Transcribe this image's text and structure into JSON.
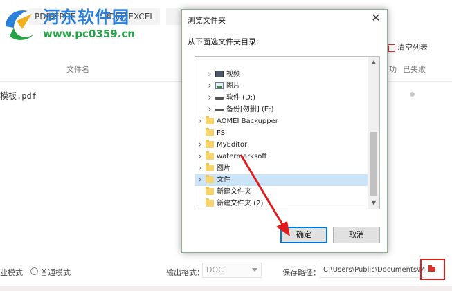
{
  "watermark": {
    "title": "河东软件园",
    "url": "www.pc0359.cn"
  },
  "app": {
    "tabs": [
      "PDF转PDF",
      "PDF转EXCEL"
    ],
    "clear_list_label": "清空列表",
    "columns": {
      "file_name": "文件名",
      "success": "功",
      "failed": "已失败"
    },
    "file_row": {
      "name": "模板.pdf"
    },
    "mode": {
      "fast_label": "业模式",
      "normal_label": "普通模式"
    },
    "output_format_label": "输出格式：",
    "output_format_value": "DOC",
    "save_path_label": "保存路径：",
    "save_path_value": "C:\\Users\\Public\\Documents\\Mini"
  },
  "dialog": {
    "title": "浏览文件夹",
    "prompt": "从下面选文件夹目录:",
    "tree": [
      {
        "label": "视频",
        "icon": "video-icon",
        "indent": 1,
        "expandable": true,
        "selected": false
      },
      {
        "label": "图片",
        "icon": "image-icon",
        "indent": 1,
        "expandable": true,
        "selected": false
      },
      {
        "label": "软件 (D:)",
        "icon": "drive-icon",
        "indent": 1,
        "expandable": true,
        "selected": false
      },
      {
        "label": "备份[勿删] (E:)",
        "icon": "drive-icon",
        "indent": 1,
        "expandable": true,
        "selected": false
      },
      {
        "label": "AOMEI Backupper",
        "icon": "folder-icon",
        "indent": 0,
        "expandable": true,
        "selected": false
      },
      {
        "label": "FS",
        "icon": "folder-icon",
        "indent": 0,
        "expandable": false,
        "selected": false
      },
      {
        "label": "MyEditor",
        "icon": "folder-icon",
        "indent": 0,
        "expandable": true,
        "selected": false
      },
      {
        "label": "watermarksoft",
        "icon": "folder-icon",
        "indent": 0,
        "expandable": true,
        "selected": false
      },
      {
        "label": "图片",
        "icon": "folder-icon",
        "indent": 0,
        "expandable": true,
        "selected": false
      },
      {
        "label": "文件",
        "icon": "folder-icon",
        "indent": 0,
        "expandable": true,
        "selected": true
      },
      {
        "label": "新建文件夹",
        "icon": "folder-icon",
        "indent": 0,
        "expandable": false,
        "selected": false
      },
      {
        "label": "新建文件夹 (2)",
        "icon": "folder-icon",
        "indent": 0,
        "expandable": false,
        "selected": false
      }
    ],
    "ok_label": "确定",
    "cancel_label": "取消"
  },
  "colors": {
    "annotation_red": "#e01b1b",
    "selection": "#cce4f7",
    "accent_blue": "#0078d7"
  }
}
